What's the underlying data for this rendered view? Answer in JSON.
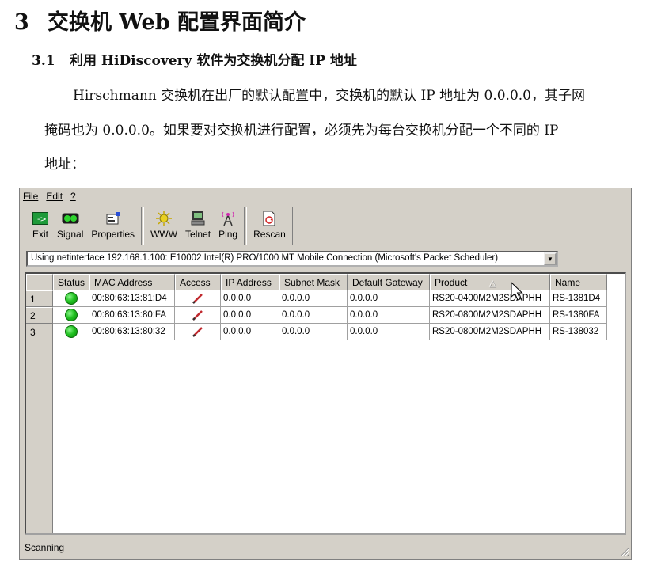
{
  "doc": {
    "title_num": "3",
    "title": "交换机 Web 配置界面简介",
    "sub_num": "3.1",
    "sub": "利用 HiDiscovery 软件为交换机分配 IP 地址",
    "para1": "Hirschmann 交换机在出厂的默认配置中，交换机的默认 IP 地址为 0.0.0.0，其子网",
    "para2": "掩码也为  0.0.0.0。如果要对交换机进行配置，必须先为每台交换机分配一个不同的  IP",
    "para3": "地址："
  },
  "menu": {
    "file": "File",
    "edit": "Edit",
    "help": "?"
  },
  "toolbar": {
    "exit": "Exit",
    "signal": "Signal",
    "properties": "Properties",
    "www": "WWW",
    "telnet": "Telnet",
    "ping": "Ping",
    "rescan": "Rescan"
  },
  "netinterface": "Using netinterface 192.168.1.100: E10002 Intel(R) PRO/1000 MT Mobile Connection (Microsoft's Packet Scheduler)",
  "columns": [
    "Status",
    "MAC Address",
    "Access",
    "IP Address",
    "Subnet Mask",
    "Default Gateway",
    "Product",
    "Name"
  ],
  "rows": [
    {
      "index": "1",
      "mac": "00:80:63:13:81:D4",
      "ip": "0.0.0.0",
      "mask": "0.0.0.0",
      "gateway": "0.0.0.0",
      "product": "RS20-0400M2M2SDAPHH",
      "name": "RS-1381D4"
    },
    {
      "index": "2",
      "mac": "00:80:63:13:80:FA",
      "ip": "0.0.0.0",
      "mask": "0.0.0.0",
      "gateway": "0.0.0.0",
      "product": "RS20-0800M2M2SDAPHH",
      "name": "RS-1380FA"
    },
    {
      "index": "3",
      "mac": "00:80:63:13:80:32",
      "ip": "0.0.0.0",
      "mask": "0.0.0.0",
      "gateway": "0.0.0.0",
      "product": "RS20-0800M2M2SDAPHH",
      "name": "RS-138032"
    }
  ],
  "status_text": "Scanning",
  "colors": {
    "status_ok": "#22c322",
    "window_bg": "#d4d0c8",
    "access_icon": "#c0282d"
  }
}
